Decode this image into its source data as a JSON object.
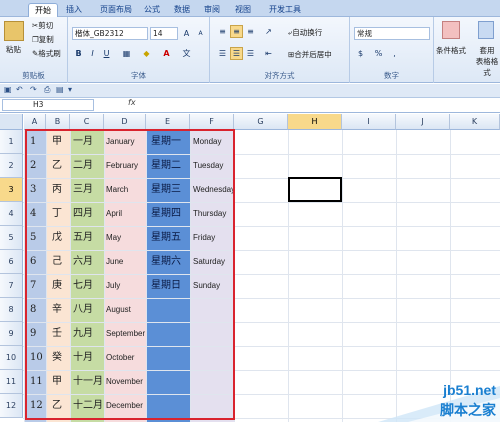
{
  "tabs": [
    "开始",
    "插入",
    "页面布局",
    "公式",
    "数据",
    "审阅",
    "视图",
    "开发工具"
  ],
  "clipboard": {
    "paste": "粘贴",
    "cut": "剪切",
    "copy": "复制",
    "format_painter": "格式刷",
    "label": "剪贴板"
  },
  "font": {
    "name": "楷体_GB2312",
    "size": "14",
    "label": "字体",
    "bold": "B",
    "italic": "I",
    "underline": "U",
    "grow": "A",
    "shrink": "A",
    "font_color": "A"
  },
  "alignment": {
    "wrap": "自动换行",
    "merge": "合并后居中",
    "label": "对齐方式"
  },
  "number": {
    "format": "常规",
    "percent": "%",
    "comma": ",",
    "label": "数字",
    "currency": "$"
  },
  "styles": {
    "conditional": "条件格式",
    "table": "套用\n表格格式"
  },
  "namebox": "H3",
  "fx": "fx",
  "columns": [
    "A",
    "B",
    "C",
    "D",
    "E",
    "F",
    "G",
    "H",
    "I",
    "J",
    "K"
  ],
  "rows": [
    "1",
    "2",
    "3",
    "4",
    "5",
    "6",
    "7",
    "8",
    "9",
    "10",
    "11",
    "12"
  ],
  "colA": [
    "1",
    "2",
    "3",
    "4",
    "5",
    "6",
    "7",
    "8",
    "9",
    "10",
    "11",
    "12"
  ],
  "colB": [
    "甲",
    "乙",
    "丙",
    "丁",
    "戊",
    "己",
    "庚",
    "辛",
    "壬",
    "癸",
    "甲",
    "乙"
  ],
  "colC": [
    "一月",
    "二月",
    "三月",
    "四月",
    "五月",
    "六月",
    "七月",
    "八月",
    "九月",
    "十月",
    "十一月",
    "十二月"
  ],
  "colD": [
    "January",
    "February",
    "March",
    "April",
    "May",
    "June",
    "July",
    "August",
    "September",
    "October",
    "November",
    "December"
  ],
  "colE": [
    "星期一",
    "星期二",
    "星期三",
    "星期四",
    "星期五",
    "星期六",
    "星期日"
  ],
  "colF": [
    "Monday",
    "Tuesday",
    "Wednesday",
    "Thursday",
    "Friday",
    "Saturday",
    "Sunday"
  ],
  "watermark": {
    "site": "jb51.net",
    "name": "脚本之家"
  },
  "colors": {
    "colA": "#b9cbe8",
    "colB": "#fbe5d3",
    "colC": "#c6dca4",
    "colD": "#f6dcdd",
    "colE": "#5b8fd6",
    "colF": "#e4e0ef",
    "border": "#d9232e"
  }
}
